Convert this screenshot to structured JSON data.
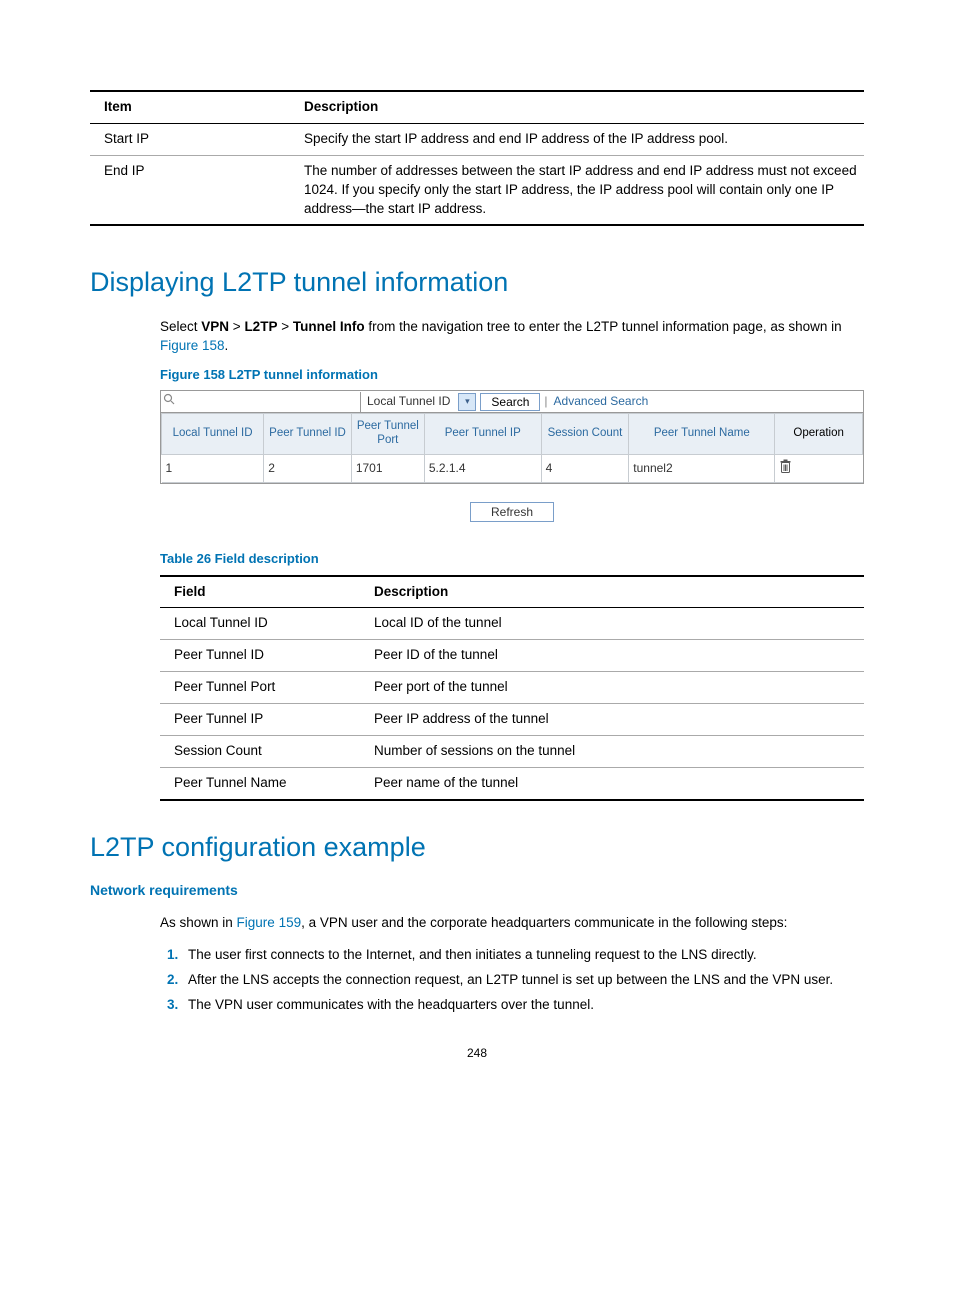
{
  "topTable": {
    "headers": {
      "c1": "Item",
      "c2": "Description"
    },
    "rows": [
      {
        "c1": "Start IP",
        "c2": "Specify the start IP address and end IP address of the IP address pool."
      },
      {
        "c1": "End IP",
        "c2": "The number of addresses between the start IP address and end IP address must not exceed 1024. If you specify only the start IP address, the IP address pool will contain only one IP address—the start IP address."
      }
    ]
  },
  "section1": {
    "heading": "Displaying L2TP tunnel information",
    "intro_prefix": "Select ",
    "crumb1": "VPN",
    "sep": " > ",
    "crumb2": "L2TP",
    "crumb3": "Tunnel Info",
    "intro_mid": " from the navigation tree to enter the L2TP tunnel information page, as shown in ",
    "intro_link": "Figure 158",
    "intro_end": ".",
    "fig_caption": "Figure 158 L2TP tunnel information",
    "search": {
      "dropdown_label": "Local Tunnel ID",
      "search_btn": "Search",
      "advanced": "Advanced Search"
    },
    "tunnel_headers": {
      "h1": "Local Tunnel ID",
      "h2": "Peer Tunnel ID",
      "h3": "Peer Tunnel Port",
      "h4": "Peer Tunnel IP",
      "h5": "Session Count",
      "h6": "Peer Tunnel Name",
      "h7": "Operation"
    },
    "tunnel_row": {
      "c1": "1",
      "c2": "2",
      "c3": "1701",
      "c4": "5.2.1.4",
      "c5": "4",
      "c6": "tunnel2"
    },
    "refresh_btn": "Refresh",
    "table_caption": "Table 26 Field description",
    "field_headers": {
      "c1": "Field",
      "c2": "Description"
    },
    "field_rows": [
      {
        "c1": "Local Tunnel ID",
        "c2": "Local ID of the tunnel"
      },
      {
        "c1": "Peer Tunnel ID",
        "c2": "Peer ID of the tunnel"
      },
      {
        "c1": "Peer Tunnel Port",
        "c2": "Peer port of the tunnel"
      },
      {
        "c1": "Peer Tunnel IP",
        "c2": "Peer IP address of the tunnel"
      },
      {
        "c1": "Session Count",
        "c2": "Number of sessions on the tunnel"
      },
      {
        "c1": "Peer Tunnel Name",
        "c2": "Peer name of the tunnel"
      }
    ]
  },
  "section2": {
    "heading": "L2TP configuration example",
    "subheading": "Network requirements",
    "para_prefix": "As shown in ",
    "para_link": "Figure 159",
    "para_suffix": ", a VPN user and the corporate headquarters communicate in the following steps:",
    "steps": [
      "The user first connects to the Internet, and then initiates a tunneling request to the LNS directly.",
      "After the LNS accepts the connection request, an L2TP tunnel is set up between the LNS and the VPN user.",
      "The VPN user communicates with the headquarters over the tunnel."
    ]
  },
  "page_number": "248"
}
